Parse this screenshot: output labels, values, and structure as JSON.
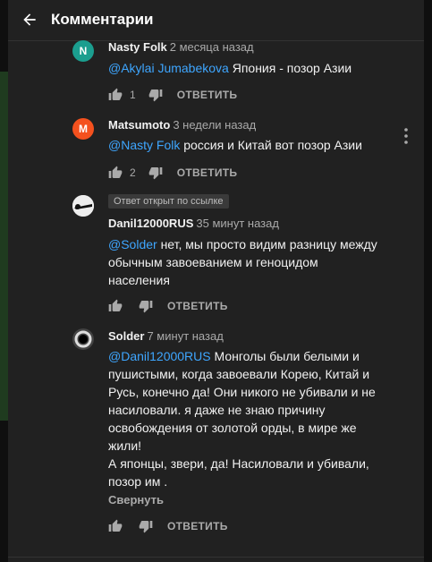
{
  "header": {
    "title": "Комментарии"
  },
  "comments": [
    {
      "avatar_letter": "N",
      "avatar_color": "#1b9e8f",
      "author": "Nasty Folk",
      "time": "2 месяца назад",
      "mention": "@Akylai Jumabekova",
      "text": " Япония - позор Азии",
      "likes": "1",
      "reply_label": "ОТВЕТИТЬ"
    },
    {
      "avatar_letter": "M",
      "avatar_color": "#f4511e",
      "author": "Matsumoto",
      "time": "3 недели назад",
      "mention": "@Nasty Folk",
      "text": " россия и Китай вот позор Азии",
      "likes": "2",
      "reply_label": "ОТВЕТИТЬ"
    },
    {
      "badge": "Ответ открыт по ссылке",
      "author": "Danil12000RUS",
      "time": "35 минут назад",
      "mention": "@Solder",
      "text_lines": [
        " нет, мы просто видим разницу между",
        "обычным завоеванием и геноцидом",
        "населения"
      ],
      "reply_label": "ОТВЕТИТЬ"
    },
    {
      "author": "Solder",
      "time": "7 минут назад",
      "mention": "@Danil12000RUS",
      "text_lines": [
        "  Монголы были белыми и",
        "пушистыми, когда завоевали Корею, Китай и",
        "Русь, конечно да! Они никого не убивали и не",
        "насиловали. я даже не знаю причину",
        "освобождения от золотой орды, в мире же",
        "жили!",
        "А японцы, звери,  да!  Насиловали и убивали,",
        "позор им ."
      ],
      "collapse_label": "Свернуть",
      "reply_label": "ОТВЕТИТЬ"
    }
  ]
}
